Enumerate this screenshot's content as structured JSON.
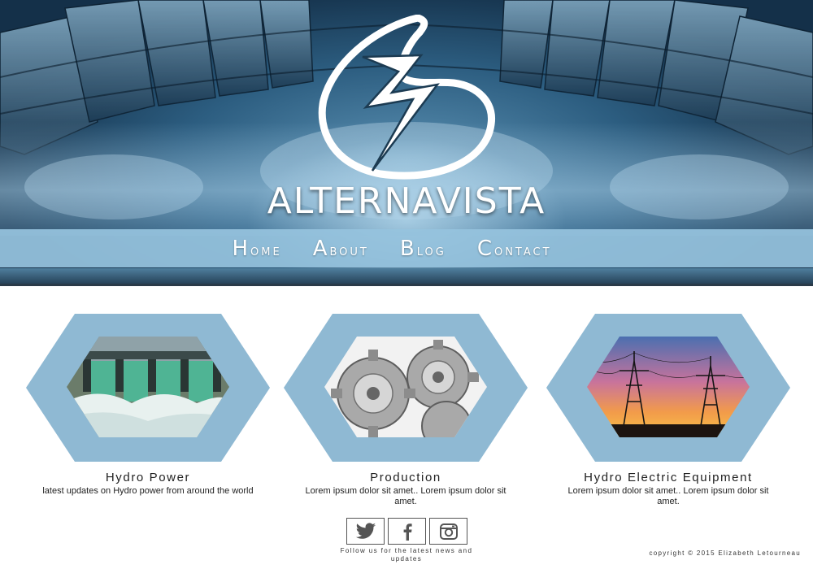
{
  "header": {
    "brand": "ALTERNAVISTA",
    "logo_icon": "lightning-swirl-logo"
  },
  "nav": {
    "items": [
      {
        "label": "Home"
      },
      {
        "label": "About"
      },
      {
        "label": "Blog"
      },
      {
        "label": "Contact"
      }
    ]
  },
  "cards": [
    {
      "title": "Hydro Power",
      "description": "latest updates on Hydro power from around the world",
      "image": "dam-spillway"
    },
    {
      "title": "Production",
      "description": "Lorem ipsum dolor sit amet.. Lorem ipsum dolor sit amet.",
      "image": "metal-gears"
    },
    {
      "title": "Hydro Electric Equipment",
      "description": "Lorem ipsum dolor sit amet.. Lorem ipsum dolor sit amet.",
      "image": "power-lines-sunset"
    }
  ],
  "footer": {
    "social": [
      {
        "icon": "twitter-icon"
      },
      {
        "icon": "facebook-icon"
      },
      {
        "icon": "instagram-icon"
      }
    ],
    "follow_text": "Follow us for the latest news and updates",
    "copyright": "copyright © 2015 Elizabeth Letourneau"
  },
  "colors": {
    "accent": "#8fb9d3",
    "nav_bar": "#96c3de",
    "text": "#222222"
  }
}
